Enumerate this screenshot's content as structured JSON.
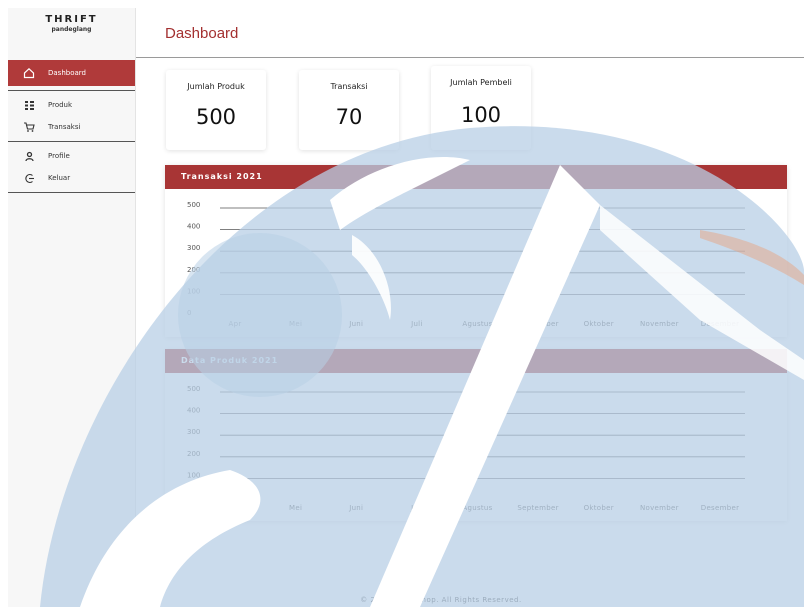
{
  "brand": {
    "title": "THRIFT",
    "subtitle": "pandeglang"
  },
  "sidebar": {
    "items": [
      {
        "label": "Dashboard",
        "icon": "home-icon"
      },
      {
        "label": "Produk",
        "icon": "grid-icon"
      },
      {
        "label": "Transaksi",
        "icon": "cart-icon"
      },
      {
        "label": "Profile",
        "icon": "user-icon"
      },
      {
        "label": "Keluar",
        "icon": "logout-icon"
      }
    ]
  },
  "header": {
    "title": "Dashboard"
  },
  "stats": [
    {
      "label": "Jumlah Produk",
      "value": "500"
    },
    {
      "label": "Transaksi",
      "value": "70"
    },
    {
      "label": "Jumlah Pembeli",
      "value": "100"
    }
  ],
  "colors": {
    "accent": "#a83535",
    "watermark": "#b8cfe6"
  },
  "chart_data": [
    {
      "type": "line",
      "title": "Transaksi 2021",
      "categories": [
        "Apr",
        "Mei",
        "Juni",
        "Juli",
        "Agustus",
        "September",
        "Oktober",
        "November",
        "Desember"
      ],
      "y_ticks": [
        "0",
        "100",
        "200",
        "300",
        "400",
        "500"
      ],
      "ylim": [
        0,
        500
      ],
      "series": [],
      "grid": true
    },
    {
      "type": "line",
      "title": "Data Produk 2021",
      "categories": [
        "Apr",
        "Mei",
        "Juni",
        "Juli",
        "Agustus",
        "September",
        "Oktober",
        "November",
        "Desember"
      ],
      "y_ticks": [
        "0",
        "100",
        "200",
        "300",
        "400",
        "500"
      ],
      "ylim": [
        0,
        500
      ],
      "series": [],
      "grid": true
    }
  ],
  "footer": {
    "text": "© 2022 Thrift shop. All Rights Reserved."
  }
}
